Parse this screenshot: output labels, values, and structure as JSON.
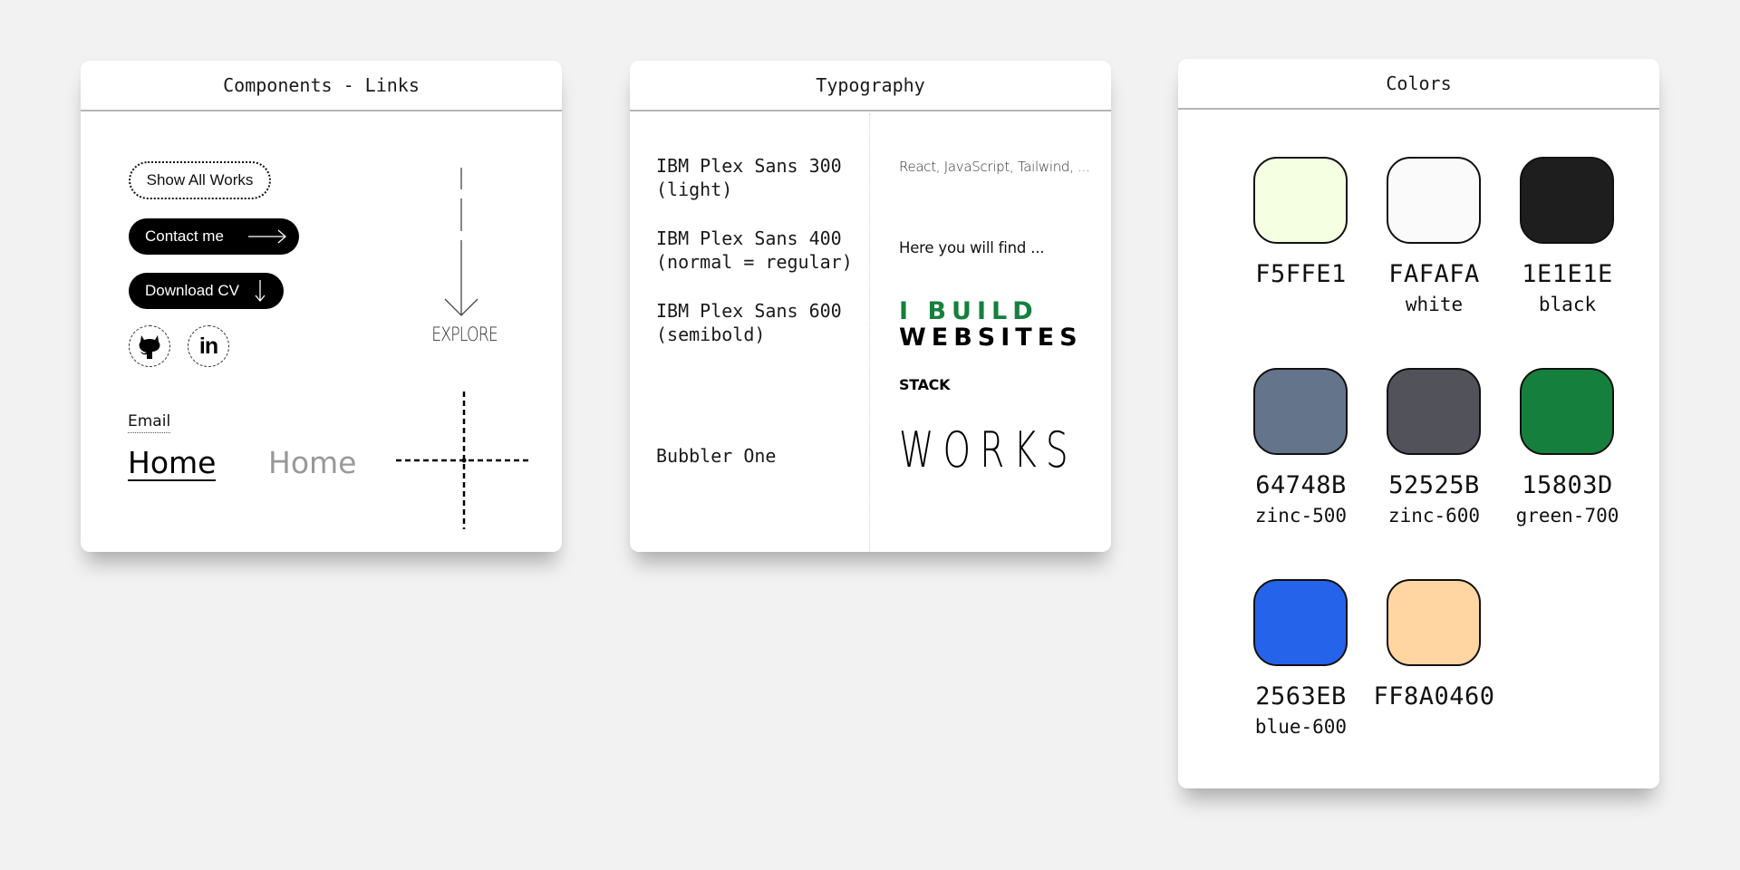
{
  "links_card": {
    "title": "Components - Links",
    "show_all_works": "Show All Works",
    "contact_me": "Contact me",
    "download_cv": "Download CV",
    "explore": "EXPLORE",
    "email": "Email",
    "home_active": "Home",
    "home_inactive": "Home",
    "social_icons": [
      "github-icon",
      "linkedin-icon"
    ],
    "linkedin_glyph": "in"
  },
  "typography_card": {
    "title": "Typography",
    "fonts": [
      {
        "name": "IBM Plex Sans 300\n(light)",
        "sample": "React, JavaScript, Tailwind, ..."
      },
      {
        "name": "IBM Plex Sans 400\n(normal = regular)",
        "sample": "Here you will find  ..."
      },
      {
        "name": "IBM Plex Sans 600\n(semibold)",
        "sample_line1": "I BUILD",
        "sample_line2": "WEBSITES",
        "sample_line3": "STACK"
      },
      {
        "name": "Bubbler One",
        "sample": "WORKS"
      }
    ],
    "accent_color": "#15803D"
  },
  "colors_card": {
    "title": "Colors",
    "swatches": [
      {
        "hex": "F5FFE1",
        "name": "",
        "color": "#F5FFE1"
      },
      {
        "hex": "FAFAFA",
        "name": "white",
        "color": "#FAFAFA"
      },
      {
        "hex": "1E1E1E",
        "name": "black",
        "color": "#1E1E1E"
      },
      {
        "hex": "64748B",
        "name": "zinc-500",
        "color": "#64748B"
      },
      {
        "hex": "52525B",
        "name": "zinc-600",
        "color": "#52525B"
      },
      {
        "hex": "15803D",
        "name": "green-700",
        "color": "#15803D"
      },
      {
        "hex": "2563EB",
        "name": "blue-600",
        "color": "#2563EB"
      },
      {
        "hex": "FF8A0460",
        "name": "",
        "color": "#FFD5A1"
      }
    ]
  }
}
